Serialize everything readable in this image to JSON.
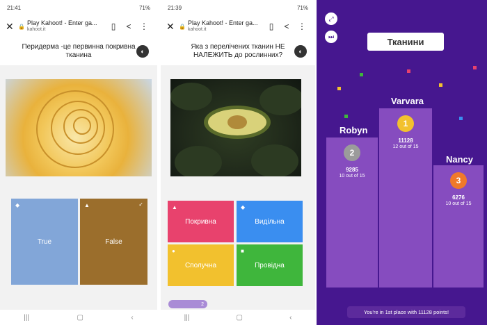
{
  "panel1": {
    "status": {
      "time": "21:41",
      "battery": "71%"
    },
    "browser": {
      "title": "Play Kahoot! - Enter ga...",
      "url": "kahoot.it"
    },
    "question": "Перидерма -це первинна покривна тканина",
    "answers": [
      {
        "label": "True",
        "color": "#82a6d8"
      },
      {
        "label": "False",
        "color": "#9b6e2c"
      }
    ]
  },
  "panel2": {
    "status": {
      "time": "21:39",
      "battery": "71%"
    },
    "browser": {
      "title": "Play Kahoot! - Enter ga...",
      "url": "kahoot.it"
    },
    "question": "Яка з перелічених тканин НЕ НАЛЕЖИТЬ до рослинних?",
    "answers": [
      {
        "label": "Покривна",
        "color": "#e8426d"
      },
      {
        "label": "Видільна",
        "color": "#3a8ef0"
      },
      {
        "label": "Сполучна",
        "color": "#f2c12e"
      },
      {
        "label": "Провідна",
        "color": "#3fb63c"
      }
    ],
    "progress": "2"
  },
  "panel3": {
    "title": "Тканини",
    "players": [
      {
        "name": "Robyn",
        "rank": "2",
        "score": "9285",
        "outof": "10 out of 15",
        "badge_color": "#9b9b9b"
      },
      {
        "name": "Varvara",
        "rank": "1",
        "score": "11128",
        "outof": "12 out of 15",
        "badge_color": "#f2c12e"
      },
      {
        "name": "Nancy",
        "rank": "3",
        "score": "6276",
        "outof": "10 out of 15",
        "badge_color": "#f0792a"
      }
    ],
    "footer": "You're in 1st place with 11128 points!"
  }
}
